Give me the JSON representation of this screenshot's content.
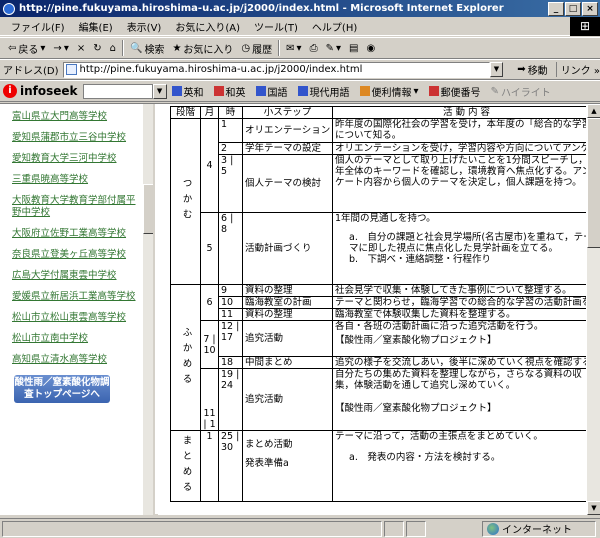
{
  "window": {
    "title": "http://pine.fukuyama.hiroshima-u.ac.jp/j2000/index.html - Microsoft Internet Explorer",
    "min": "_",
    "max": "□",
    "close": "×"
  },
  "menu": [
    "ファイル(F)",
    "編集(E)",
    "表示(V)",
    "お気に入り(A)",
    "ツール(T)",
    "ヘルプ(H)"
  ],
  "toolbar": {
    "back": "戻る",
    "forward": "→",
    "stop": "×",
    "refresh": "↻",
    "home": "⌂",
    "search": "検索",
    "favorites": "お気に入り",
    "history": "履歴"
  },
  "address": {
    "label": "アドレス(D)",
    "url": "http://pine.fukuyama.hiroshima-u.ac.jp/j2000/index.html",
    "go": "移動",
    "links": "リンク"
  },
  "searchbar": {
    "brand": "infoseek",
    "buttons": [
      "英和",
      "和英",
      "国語",
      "現代用語",
      "便利情報",
      "郵便番号",
      "ハイライト"
    ]
  },
  "colors": {
    "link": "#337733",
    "titlebar": "#0a246a",
    "chrome": "#d4d0c8"
  },
  "sidebar": {
    "links": [
      "富山県立大門高等学校",
      "愛知県蒲郡市立三谷中学校",
      "愛知教育大学三河中学校",
      "三重県暁高等学校",
      "大阪教育大学教育学部付属平野中学校",
      "大阪府立佐野工業高等学校",
      "奈良県立登美ヶ丘高等学校",
      "広島大学付属東雲中学校",
      "愛媛県立新居浜工業高等学校",
      "松山市立松山東雲高等学校",
      "松山市立南中学校",
      "高知県立清水高等学校"
    ],
    "banner": "酸性雨／窒素酸化物調査トップページへ"
  },
  "table": {
    "headers": [
      "段階",
      "月",
      "時",
      "小ステップ",
      "活 動 内 容"
    ],
    "rows": [
      {
        "phase": "つかむ",
        "month": "4",
        "hour": "1",
        "step": "オリエンテーション",
        "content": "昨年度の国際化社会の学習を受け，本年度の「総合的な学習」について知る。"
      },
      {
        "hour": "2",
        "step": "学年テーマの設定",
        "content": "オリエンテーションを受け，学習内容や方向についてアンケートを行う。"
      },
      {
        "hour": "3 | 5",
        "step": "個人テーマの検討",
        "content": "個人のテーマとして取り上げたいことを1分間スピーチし，学年全体のキーワードを確認し，環境教育へ焦点化する。アンケート内容から個人のテーマを決定し，個人課題を持つ。"
      },
      {
        "month": "5",
        "hour": "6 | 8",
        "step": "活動計画づくり",
        "content": "1年間の見通しを持つ。",
        "items": [
          "a.　自分の課題と社会見学場所(名古屋市)を重ねて，テーマに即した視点に焦点化した見学計画を立てる。",
          "b.　下調べ・連絡調整・行程作り"
        ]
      },
      {
        "phase": "ふかめる",
        "month": "6",
        "hour": "9",
        "step": "資料の整理",
        "content": "社会見学で収集・体験してきた事例について整理する。"
      },
      {
        "hour": "10",
        "step": "臨海教室の計画",
        "content": "テーマと関わらせ，臨海学習での総合的な学習の活動計画を立てる。"
      },
      {
        "hour": "11",
        "step": "資料の整理",
        "content": "臨海教室で体験収集した資料を整理する。"
      },
      {
        "month": "7 | 10",
        "hour": "12 | 17",
        "step": "追究活動",
        "content": "各自・各班の活動計画に沿った追究活動を行う。",
        "project": "【酸性雨／窒素酸化物プロジェクト】"
      },
      {
        "hour": "18",
        "step": "中間まとめ",
        "content": "追究の様子を交流しあい，後半に深めていく視点を確認する。"
      },
      {
        "month": "11 | 1",
        "hour": "19 | 24",
        "step": "追究活動",
        "content": "自分たちの集めた資料を整理しながら，さらなる資料の収集，体験活動を通して追究し深めていく。",
        "project": "【酸性雨／窒素酸化物プロジェクト】"
      },
      {
        "phase": "まとめる",
        "month": "1",
        "hour": "25 | 30",
        "step": "まとめ活動",
        "step2": "発表準備a",
        "content": "テーマに沿って，活動の主張点をまとめていく。",
        "items": [
          "a.　発表の内容・方法を検討する。"
        ]
      }
    ]
  },
  "status": {
    "zone": "インターネット"
  }
}
